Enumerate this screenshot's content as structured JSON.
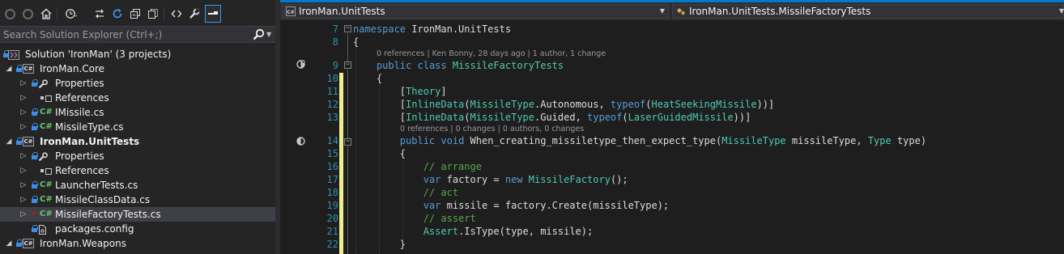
{
  "solution_explorer": {
    "toolbar": {
      "back_icon": "back-icon",
      "forward_icon": "forward-icon",
      "home_icon": "home-icon",
      "history_icon": "history-icon",
      "sync_icon": "sync-icon",
      "refresh_icon": "refresh-icon",
      "collapse_icon": "collapse-all-icon",
      "show_all_icon": "show-all-files-icon",
      "view_code_icon": "view-code-icon",
      "properties_icon": "wrench-icon",
      "preview_icon": "preview-selected-icon"
    },
    "search": {
      "placeholder": "Search Solution Explorer (Ctrl+;)"
    },
    "tree": [
      {
        "label": "Solution 'IronMan' (3 projects)",
        "type": "solution"
      },
      {
        "label": "IronMan.Core",
        "type": "project"
      },
      {
        "label": "Properties",
        "type": "properties"
      },
      {
        "label": "References",
        "type": "references"
      },
      {
        "label": "IMissile.cs",
        "type": "csfile"
      },
      {
        "label": "MissileType.cs",
        "type": "csfile"
      },
      {
        "label": "IronMan.UnitTests",
        "type": "project",
        "bold": true
      },
      {
        "label": "Properties",
        "type": "properties"
      },
      {
        "label": "References",
        "type": "references"
      },
      {
        "label": "LauncherTests.cs",
        "type": "csfile"
      },
      {
        "label": "MissileClassData.cs",
        "type": "csfile"
      },
      {
        "label": "MissileFactoryTests.cs",
        "type": "csfile",
        "selected": true,
        "modified": true
      },
      {
        "label": "packages.config",
        "type": "config"
      },
      {
        "label": "IronMan.Weapons",
        "type": "project"
      }
    ]
  },
  "editor": {
    "nav": {
      "project": "IronMan.UnitTests",
      "type": "IronMan.UnitTests.MissileFactoryTests"
    },
    "lens": [
      "0 references | Ken Bonny, 28 days ago | 1 author, 1 change",
      "0 references | 0 changes | 0 authors, 0 changes"
    ],
    "line_numbers": [
      "7",
      "8",
      "9",
      "10",
      "11",
      "12",
      "13",
      "14",
      "15",
      "16",
      "17",
      "18",
      "19",
      "20",
      "21",
      "22"
    ],
    "code": [
      [
        [
          "kw",
          "namespace"
        ],
        [
          "tx",
          " IronMan.UnitTests"
        ]
      ],
      [
        [
          "tx",
          "{"
        ]
      ],
      [
        [
          "tx",
          "    "
        ],
        [
          "kw",
          "public"
        ],
        [
          "tx",
          " "
        ],
        [
          "kw",
          "class"
        ],
        [
          "tx",
          " "
        ],
        [
          "ty",
          "MissileFactoryTests"
        ]
      ],
      [
        [
          "tx",
          "    {"
        ]
      ],
      [
        [
          "tx",
          "        ["
        ],
        [
          "ty",
          "Theory"
        ],
        [
          "tx",
          "]"
        ]
      ],
      [
        [
          "tx",
          "        ["
        ],
        [
          "ty",
          "InlineData"
        ],
        [
          "tx",
          "("
        ],
        [
          "ty",
          "MissileType"
        ],
        [
          "tx",
          ".Autonomous, "
        ],
        [
          "kw",
          "typeof"
        ],
        [
          "tx",
          "("
        ],
        [
          "ty",
          "HeatSeekingMissile"
        ],
        [
          "tx",
          "))]"
        ]
      ],
      [
        [
          "tx",
          "        ["
        ],
        [
          "ty",
          "InlineData"
        ],
        [
          "tx",
          "("
        ],
        [
          "ty",
          "MissileType"
        ],
        [
          "tx",
          ".Guided, "
        ],
        [
          "kw",
          "typeof"
        ],
        [
          "tx",
          "("
        ],
        [
          "ty",
          "LaserGuidedMissile"
        ],
        [
          "tx",
          "))]"
        ]
      ],
      [
        [
          "tx",
          "        "
        ],
        [
          "kw",
          "public"
        ],
        [
          "tx",
          " "
        ],
        [
          "kw",
          "void"
        ],
        [
          "tx",
          " When_creating_missiletype_then_expect_type("
        ],
        [
          "ty",
          "MissileType"
        ],
        [
          "tx",
          " missileType, "
        ],
        [
          "ty",
          "Type"
        ],
        [
          "tx",
          " type)"
        ]
      ],
      [
        [
          "tx",
          "        {"
        ]
      ],
      [
        [
          "tx",
          "            "
        ],
        [
          "cm",
          "// arrange"
        ]
      ],
      [
        [
          "tx",
          "            "
        ],
        [
          "kw",
          "var"
        ],
        [
          "tx",
          " factory = "
        ],
        [
          "kw",
          "new"
        ],
        [
          "tx",
          " "
        ],
        [
          "ty",
          "MissileFactory"
        ],
        [
          "tx",
          "();"
        ]
      ],
      [
        [
          "tx",
          "            "
        ],
        [
          "cm",
          "// act"
        ]
      ],
      [
        [
          "tx",
          "            "
        ],
        [
          "kw",
          "var"
        ],
        [
          "tx",
          " missile = factory.Create(missileType);"
        ]
      ],
      [
        [
          "tx",
          "            "
        ],
        [
          "cm",
          "// assert"
        ]
      ],
      [
        [
          "tx",
          "            "
        ],
        [
          "ty",
          "Assert"
        ],
        [
          "tx",
          ".IsType(type, missile);"
        ]
      ],
      [
        [
          "tx",
          "        }"
        ]
      ]
    ],
    "colors": {
      "keyword": "#569cd6",
      "type": "#4ec9b0",
      "comment": "#57a64a",
      "text": "#dcdcdc",
      "line_number": "#2b91af",
      "accent": "#007acc"
    }
  }
}
